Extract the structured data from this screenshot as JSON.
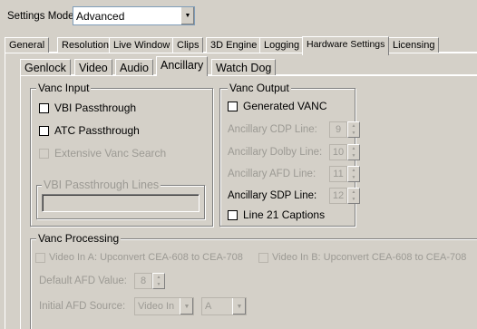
{
  "settings_mode": {
    "label": "Settings Mode:",
    "value": "Advanced"
  },
  "main_tabs": [
    "General",
    "Resolution",
    "Live Window",
    "Clips",
    "3D Engine",
    "Logging",
    "Hardware Settings",
    "Licensing"
  ],
  "sub_tabs": [
    "Genlock",
    "Video",
    "Audio",
    "Ancillary",
    "Watch Dog"
  ],
  "vanc_input": {
    "title": "Vanc Input",
    "vbi_passthrough": "VBI Passthrough",
    "atc_passthrough": "ATC Passthrough",
    "extensive_search": "Extensive Vanc Search",
    "vbi_lines_title": "VBI Passthrough Lines"
  },
  "vanc_output": {
    "title": "Vanc Output",
    "generated_vanc": "Generated VANC",
    "cdp_label": "Ancillary CDP Line:",
    "cdp_value": "9",
    "dolby_label": "Ancillary Dolby Line:",
    "dolby_value": "10",
    "afd_label": "Ancillary AFD Line:",
    "afd_value": "11",
    "sdp_label": "Ancillary SDP Line:",
    "sdp_value": "12",
    "line21": "Line 21 Captions"
  },
  "vanc_processing": {
    "title": "Vanc Processing",
    "upconvert_a": "Video In A: Upconvert CEA-608 to CEA-708",
    "upconvert_b": "Video In B: Upconvert CEA-608 to CEA-708",
    "default_afd_label": "Default AFD Value:",
    "default_afd_value": "8",
    "initial_afd_label": "Initial AFD Source:",
    "afd_source_value": "Video In",
    "afd_channel_value": "A"
  }
}
